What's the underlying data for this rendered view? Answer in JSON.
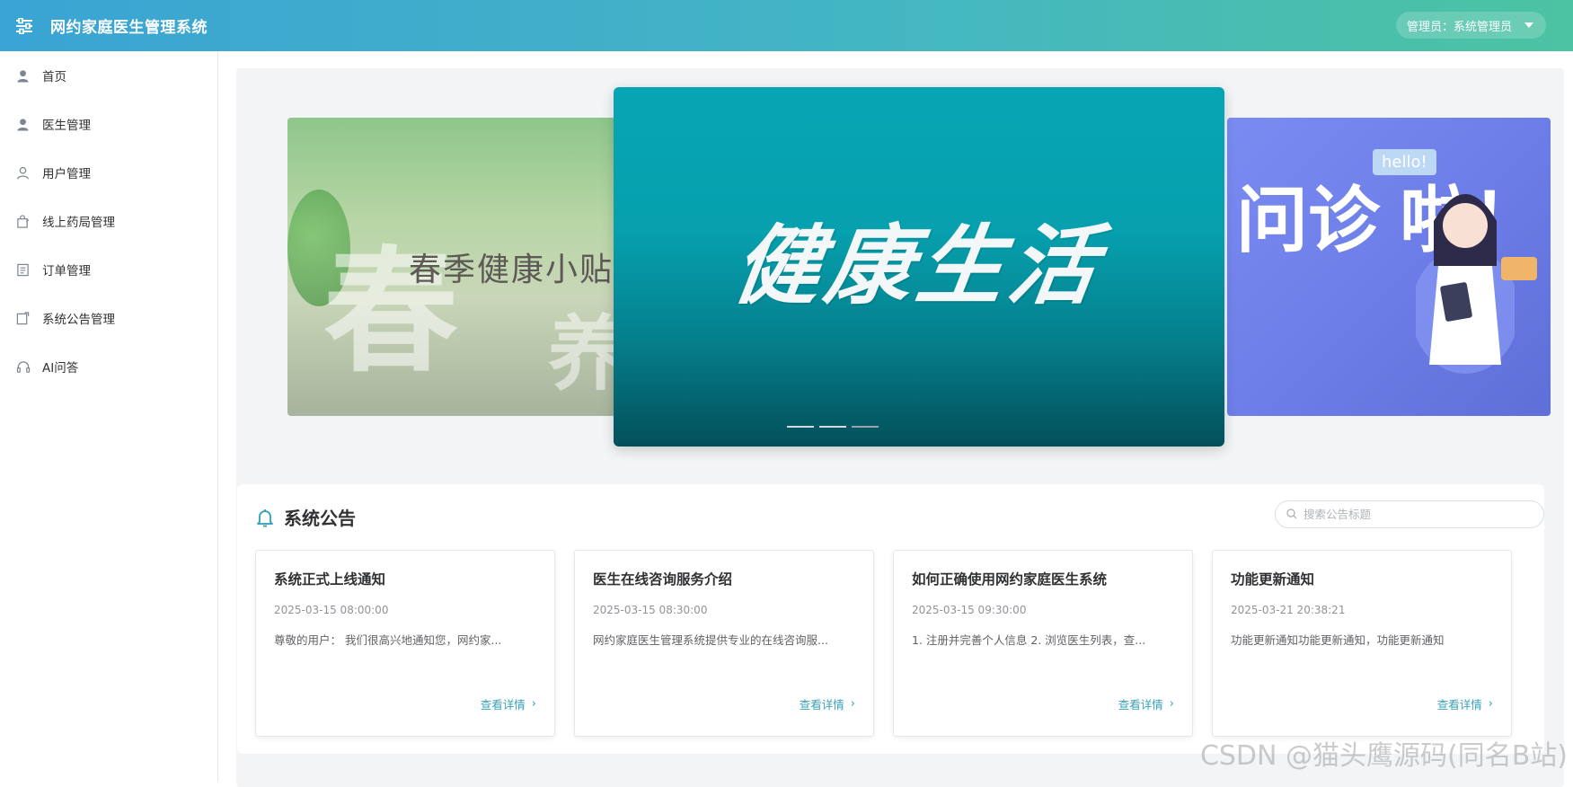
{
  "header": {
    "title": "网约家庭医生管理系统",
    "user_label": "管理员：系统管理员"
  },
  "sidebar": {
    "items": [
      {
        "label": "首页",
        "icon": "user-icon"
      },
      {
        "label": "医生管理",
        "icon": "user-icon"
      },
      {
        "label": "用户管理",
        "icon": "user-outline-icon"
      },
      {
        "label": "线上药局管理",
        "icon": "shopping-bag-icon"
      },
      {
        "label": "订单管理",
        "icon": "document-icon"
      },
      {
        "label": "系统公告管理",
        "icon": "notebook-icon"
      },
      {
        "label": "AI问答",
        "icon": "headset-icon"
      }
    ]
  },
  "carousel": {
    "left_slide_text": "春季健康小贴",
    "center_slide_text": "健康生活",
    "right_slide_text": "问诊 啦！",
    "right_bubble": "hello!",
    "slide_count": 3,
    "active_index": 2
  },
  "notices": {
    "section_title": "系统公告",
    "search_placeholder": "搜索公告标题",
    "more_label": "查看详情",
    "items": [
      {
        "title": "系统正式上线通知",
        "date": "2025-03-15 08:00:00",
        "summary": "尊敬的用户： 我们很高兴地通知您，网约家..."
      },
      {
        "title": "医生在线咨询服务介绍",
        "date": "2025-03-15 08:30:00",
        "summary": "网约家庭医生管理系统提供专业的在线咨询服..."
      },
      {
        "title": "如何正确使用网约家庭医生系统",
        "date": "2025-03-15 09:30:00",
        "summary": "1. 注册并完善个人信息 2. 浏览医生列表，查..."
      },
      {
        "title": "功能更新通知",
        "date": "2025-03-21 20:38:21",
        "summary": "功能更新通知功能更新通知，功能更新通知"
      }
    ]
  },
  "watermark": "CSDN @猫头鹰源码(同名B站)",
  "colors": {
    "header_start": "#3aa4d4",
    "header_end": "#4cc3a2",
    "link": "#3aa0b8",
    "center_slide": "#06a0ae"
  }
}
